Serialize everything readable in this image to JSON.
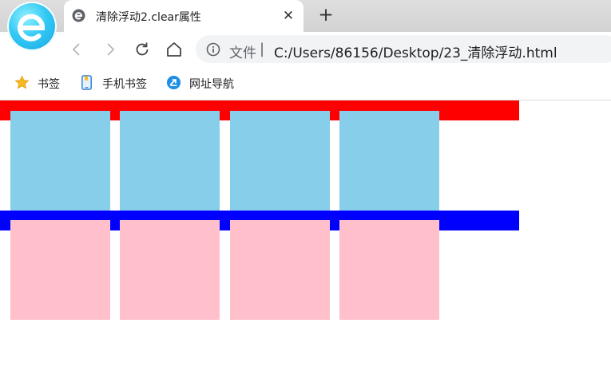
{
  "tab": {
    "title": "清除浮动2.clear属性",
    "close_symbol": "✕",
    "favicon": "ie-e-icon"
  },
  "new_tab_symbol": "+",
  "toolbar": {
    "back": "back-arrow-icon",
    "forward": "forward-arrow-icon",
    "reload": "reload-icon",
    "home": "home-icon"
  },
  "omnibox": {
    "scheme_label": "文件",
    "separator": "|",
    "url": "C:/Users/86156/Desktop/23_清除浮动.html"
  },
  "bookmarks": [
    {
      "label": "书签",
      "icon": "star-icon"
    },
    {
      "label": "手机书签",
      "icon": "phone-bookmark-icon"
    },
    {
      "label": "网址导航",
      "icon": "navigation-icon"
    }
  ],
  "page": {
    "first_container_color": "#ff0000",
    "second_container_color": "#0000ff",
    "first_boxes_color": "#87ceeb",
    "second_boxes_color": "#ffc0cb",
    "first_boxes_count": 4,
    "second_boxes_count": 4
  }
}
